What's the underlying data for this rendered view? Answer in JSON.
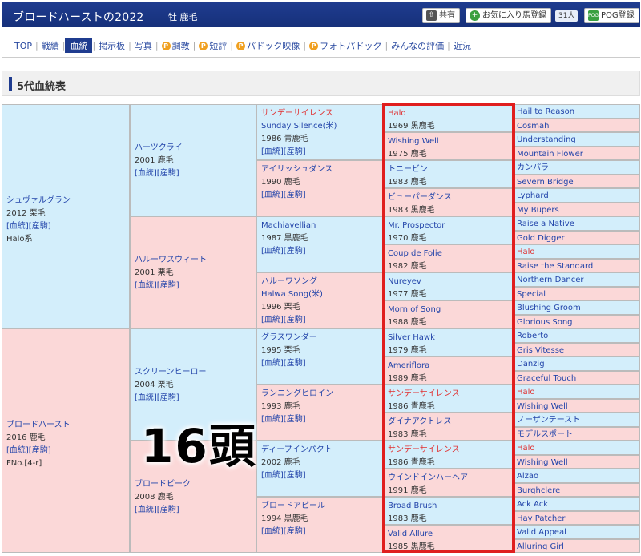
{
  "header": {
    "title": "ブロードハーストの2022",
    "subtitle": "牡 鹿毛",
    "share_label": "共有",
    "favorite_label": "お気に入り馬登録",
    "favorite_count": "31人",
    "pog_label": "POG登録"
  },
  "nav": {
    "items": [
      {
        "label": "TOP",
        "p": false,
        "active": false
      },
      {
        "label": "戦績",
        "p": false,
        "active": false
      },
      {
        "label": "血統",
        "p": false,
        "active": true
      },
      {
        "label": "掲示板",
        "p": false,
        "active": false
      },
      {
        "label": "写真",
        "p": false,
        "active": false
      },
      {
        "label": "調教",
        "p": true,
        "active": false
      },
      {
        "label": "短評",
        "p": true,
        "active": false
      },
      {
        "label": "パドック映像",
        "p": true,
        "active": false
      },
      {
        "label": "フォトパドック",
        "p": true,
        "active": false
      },
      {
        "label": "みんなの評価",
        "p": false,
        "active": false
      },
      {
        "label": "近況",
        "p": false,
        "active": false
      }
    ]
  },
  "section_title": "5代血統表",
  "links": "[血統][産駒]",
  "overlay_text": "16頭",
  "pedigree": {
    "g1": [
      {
        "name": "シュヴァルグラン",
        "year": "2012 栗毛",
        "extra": "Halo系"
      },
      {
        "name": "ブロードハースト",
        "year": "2016 鹿毛",
        "extra": "FNo.[4-r]"
      }
    ],
    "g2": [
      {
        "name": "ハーツクライ",
        "year": "2001 鹿毛"
      },
      {
        "name": "ハルーワスウィート",
        "year": "2001 栗毛"
      },
      {
        "name": "スクリーンヒーロー",
        "year": "2004 栗毛"
      },
      {
        "name": "ブロードピーク",
        "year": "2008 鹿毛"
      }
    ],
    "g3": [
      {
        "name": "サンデーサイレンス",
        "en": "Sunday Silence(米)",
        "year": "1986 青鹿毛",
        "red": true
      },
      {
        "name": "アイリッシュダンス",
        "en": "",
        "year": "1990 鹿毛",
        "red": false
      },
      {
        "name": "Machiavellian",
        "en": "",
        "year": "1987 黒鹿毛",
        "red": false
      },
      {
        "name": "ハルーワソング",
        "en": "Halwa Song(米)",
        "year": "1996 栗毛",
        "red": false
      },
      {
        "name": "グラスワンダー",
        "en": "",
        "year": "1995 栗毛",
        "red": false
      },
      {
        "name": "ランニングヒロイン",
        "en": "",
        "year": "1993 鹿毛",
        "red": false
      },
      {
        "name": "ディープインパクト",
        "en": "",
        "year": "2002 鹿毛",
        "red": false
      },
      {
        "name": "ブロードアピール",
        "en": "",
        "year": "1994 黒鹿毛",
        "red": false
      }
    ],
    "g4": [
      {
        "name": "Halo",
        "year": "1969 黒鹿毛",
        "red": true
      },
      {
        "name": "Wishing Well",
        "year": "1975 鹿毛",
        "red": false
      },
      {
        "name": "トニービン",
        "year": "1983 鹿毛",
        "red": false
      },
      {
        "name": "ビューパーダンス",
        "year": "1983 黒鹿毛",
        "red": false
      },
      {
        "name": "Mr. Prospector",
        "year": "1970 鹿毛",
        "red": false
      },
      {
        "name": "Coup de Folie",
        "year": "1982 鹿毛",
        "red": false
      },
      {
        "name": "Nureyev",
        "year": "1977 鹿毛",
        "red": false
      },
      {
        "name": "Morn of Song",
        "year": "1988 鹿毛",
        "red": false
      },
      {
        "name": "Silver Hawk",
        "year": "1979 鹿毛",
        "red": false
      },
      {
        "name": "Ameriflora",
        "year": "1989 鹿毛",
        "red": false
      },
      {
        "name": "サンデーサイレンス",
        "year": "1986 青鹿毛",
        "red": true
      },
      {
        "name": "ダイナアクトレス",
        "year": "1983 鹿毛",
        "red": false
      },
      {
        "name": "サンデーサイレンス",
        "year": "1986 青鹿毛",
        "red": true
      },
      {
        "name": "ウインドインハーヘア",
        "year": "1991 鹿毛",
        "red": false
      },
      {
        "name": "Broad Brush",
        "year": "1983 鹿毛",
        "red": false
      },
      {
        "name": "Valid Allure",
        "year": "1985 黒鹿毛",
        "red": false
      }
    ],
    "g5": [
      {
        "name": "Hail to Reason",
        "red": false
      },
      {
        "name": "Cosmah",
        "red": false
      },
      {
        "name": "Understanding",
        "red": false
      },
      {
        "name": "Mountain Flower",
        "red": false
      },
      {
        "name": "カンパラ",
        "red": false
      },
      {
        "name": "Severn Bridge",
        "red": false
      },
      {
        "name": "Lyphard",
        "red": false
      },
      {
        "name": "My Bupers",
        "red": false
      },
      {
        "name": "Raise a Native",
        "red": false
      },
      {
        "name": "Gold Digger",
        "red": false
      },
      {
        "name": "Halo",
        "red": true
      },
      {
        "name": "Raise the Standard",
        "red": false
      },
      {
        "name": "Northern Dancer",
        "red": false
      },
      {
        "name": "Special",
        "red": false
      },
      {
        "name": "Blushing Groom",
        "red": false
      },
      {
        "name": "Glorious Song",
        "red": false
      },
      {
        "name": "Roberto",
        "red": false
      },
      {
        "name": "Gris Vitesse",
        "red": false
      },
      {
        "name": "Danzig",
        "red": false
      },
      {
        "name": "Graceful Touch",
        "red": false
      },
      {
        "name": "Halo",
        "red": true
      },
      {
        "name": "Wishing Well",
        "red": false
      },
      {
        "name": "ノーザンテースト",
        "red": false
      },
      {
        "name": "モデルスポート",
        "red": false
      },
      {
        "name": "Halo",
        "red": true
      },
      {
        "name": "Wishing Well",
        "red": false
      },
      {
        "name": "Alzao",
        "red": false
      },
      {
        "name": "Burghclere",
        "red": false
      },
      {
        "name": "Ack Ack",
        "red": false
      },
      {
        "name": "Hay Patcher",
        "red": false
      },
      {
        "name": "Valid Appeal",
        "red": false
      },
      {
        "name": "Alluring Girl",
        "red": false
      }
    ]
  },
  "colors": {
    "male_bg": "#d3eefb",
    "female_bg": "#fbd8d8",
    "highlight": "#e01e1e",
    "header_bg": "#1f3c8f"
  }
}
